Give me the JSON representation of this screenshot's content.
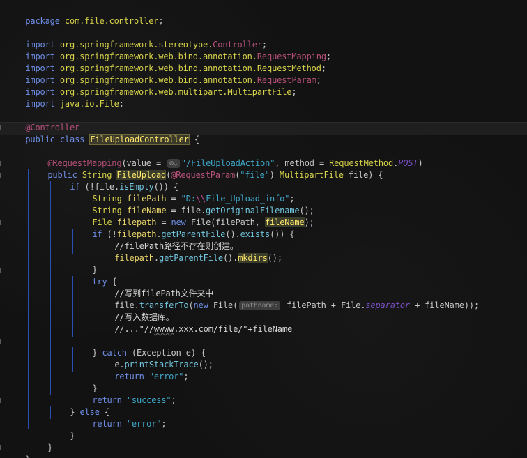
{
  "editor": {
    "lines": {
      "l1": {
        "kw": "package",
        "pkg": "com.file.controller",
        "end": ";"
      },
      "l3": {
        "kw": "import",
        "pkg": "org.springframework.stereotype.",
        "cls": "Controller",
        "end": ";"
      },
      "l4": {
        "kw": "import",
        "pkg": "org.springframework.web.bind.annotation.",
        "cls": "RequestMapping",
        "end": ";"
      },
      "l5": {
        "kw": "import",
        "pkg": "org.springframework.web.bind.annotation.",
        "cls": "RequestMethod",
        "end": ";"
      },
      "l6": {
        "kw": "import",
        "pkg": "org.springframework.web.bind.annotation.",
        "cls": "RequestParam",
        "end": ";"
      },
      "l7": {
        "kw": "import",
        "pkg": "org.springframework.web.multipart.",
        "cls": "MultipartFile",
        "end": ";"
      },
      "l8": {
        "kw": "import",
        "pkg": "java.io.",
        "cls": "File",
        "end": ";"
      },
      "l10": {
        "ann": "@Controller"
      },
      "l11": {
        "kw1": "public",
        "kw2": "class",
        "name": "FileUploadController",
        "end": "{"
      },
      "l13": {
        "ann": "@RequestMapping",
        "p1": "(value = ",
        "hint": "⚙⌄",
        "str": "\"/FileUploadAction\"",
        "p2": ", method = ",
        "cls": "RequestMethod",
        "dot": ".",
        "field": "POST",
        "end": ")"
      },
      "l14": {
        "kw1": "public",
        "type": "String",
        "name": "FileUpload",
        "p1": "(",
        "ann": "@RequestParam",
        "p2": "(",
        "str": "\"file\"",
        "p3": ") ",
        "cls": "MultipartFile",
        "p4": " file) {"
      },
      "l15": {
        "kw": "if",
        "p1": " (!file.",
        "met": "isEmpty",
        "p2": "()) {"
      },
      "l16": {
        "type": "String",
        "var": " filePath",
        "p1": " = ",
        "str1": "\"D:",
        "esc": "\\\\",
        "str2": "File_Upload_info\"",
        "end": ";"
      },
      "l17": {
        "type": "String",
        "var": " fileName",
        "p1": " = file.",
        "met": "getOriginalFilename",
        "p2": "();"
      },
      "l18": {
        "type": "File",
        "var": " filepath",
        "p1": " = ",
        "kw": "new",
        "p2": " File(filePath, ",
        "hl": "fileName",
        "end": ");"
      },
      "l19": {
        "kw": "if",
        "p1": " (!",
        "v": "filepath",
        "p2": ".",
        "met": "getParentFile",
        "p3": "().",
        "met2": "exists",
        "p4": "()) {"
      },
      "l20": {
        "cmt": "//filePath路径不存在则创建。"
      },
      "l21": {
        "v": "filepath",
        "p1": ".",
        "met": "getParentFile",
        "p2": "().",
        "hl": "mkdirs",
        "end": "();"
      },
      "l22": {
        "end": "}"
      },
      "l23": {
        "kw": "try",
        "end": " {"
      },
      "l24": {
        "cmt": "//写到filePath文件夹中"
      },
      "l25": {
        "p1": "file.",
        "met": "transferTo",
        "p2": "(",
        "kw": "new",
        "p3": " File(",
        "hint": "pathname:",
        "p4": " filePath + File.",
        "field": "separator",
        "p5": " + fileName));"
      },
      "l26": {
        "cmt": "//写入数据库。"
      },
      "l27": {
        "cmt1": "//...\"//",
        "cmt2": "wwww",
        "cmt3": ".xxx.com/file/\"+fileName"
      },
      "l29": {
        "p1": "} ",
        "kw": "catch",
        "p2": " (Exception e) {"
      },
      "l30": {
        "p1": "e.",
        "met": "printStackTrace",
        "p2": "();"
      },
      "l31": {
        "kw": "return",
        "str": " \"error\"",
        "end": ";"
      },
      "l32": {
        "end": "}"
      },
      "l33": {
        "kw": "return",
        "str": " \"success\"",
        "end": ";"
      },
      "l34": {
        "p1": "} ",
        "kw": "else",
        "p2": " {"
      },
      "l35": {
        "kw": "return",
        "str": " \"error\"",
        "end": ";"
      },
      "l36": {
        "end": "}"
      },
      "l37": {
        "end": "}"
      },
      "l38": {
        "end": "}"
      }
    }
  }
}
